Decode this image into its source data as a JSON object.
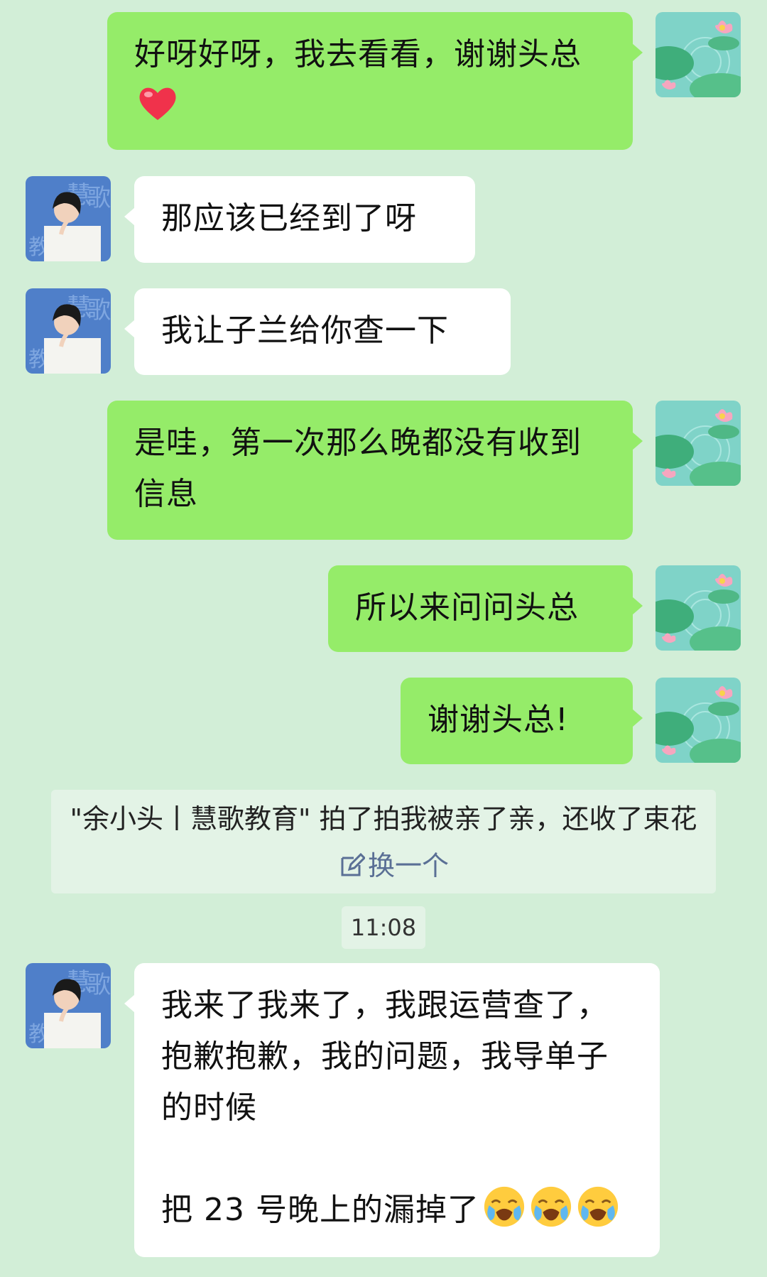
{
  "messages": {
    "m1": "好呀好呀，我去看看，谢谢头总",
    "m2": "那应该已经到了呀",
    "m3": "我让子兰给你查一下",
    "m4": "是哇，第一次那么晚都没有收到信息",
    "m5": "所以来问问头总",
    "m6": "谢谢头总!",
    "m7a": "我来了我来了，我跟运营查了，抱歉抱歉，我的问题，我导单子的时候",
    "m7b": "把 23 号晚上的漏掉了"
  },
  "system_notice": {
    "text": "\"余小头丨慧歌教育\" 拍了拍我被亲了亲，还收了束花",
    "action_label": "换一个"
  },
  "timestamp": "11:08",
  "colors": {
    "background": "#d2eed7",
    "my_bubble": "#95ec69",
    "other_bubble": "#ffffff"
  },
  "icons": {
    "heart": "red-heart-emoji",
    "crying": "loudly-crying-face-emoji",
    "edit": "edit-icon"
  }
}
